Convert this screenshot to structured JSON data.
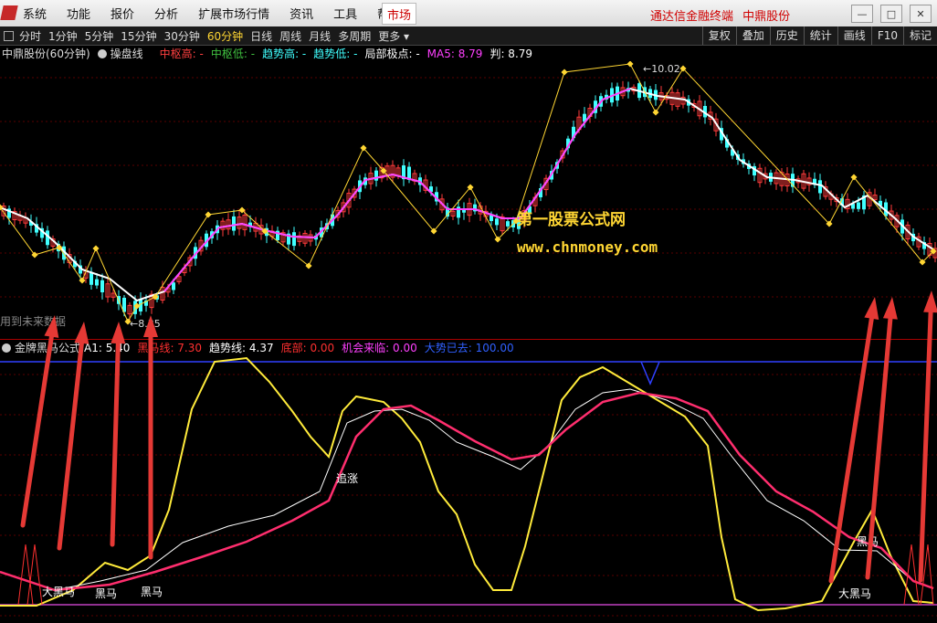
{
  "menu": {
    "items": [
      "系统",
      "功能",
      "报价",
      "分析",
      "扩展市场行情",
      "资讯",
      "工具",
      "帮助"
    ],
    "market_tab": "市场",
    "brand": "通达信金融终端",
    "stock": "中鼎股份"
  },
  "periods": {
    "items": [
      "分时",
      "1分钟",
      "5分钟",
      "15分钟",
      "30分钟",
      "60分钟",
      "日线",
      "周线",
      "月线",
      "多周期",
      "更多"
    ],
    "active": "60分钟",
    "right_items": [
      "复权",
      "叠加",
      "历史",
      "统计",
      "画线",
      "F10",
      "标记"
    ]
  },
  "main_info": {
    "stock_period": "中鼎股份(60分钟)",
    "indicator": "操盘线",
    "items": [
      {
        "label": "中枢高:",
        "value": "-",
        "color": "#ff4040"
      },
      {
        "label": "中枢低:",
        "value": "-",
        "color": "#40c040"
      },
      {
        "label": "趋势高:",
        "value": "-",
        "color": "#40ffff"
      },
      {
        "label": "趋势低:",
        "value": "-",
        "color": "#40ffff"
      },
      {
        "label": "局部极点:",
        "value": "-",
        "color": "#ffffff"
      },
      {
        "label": "MA5:",
        "value": "8.79",
        "color": "#ff40ff"
      },
      {
        "label": "判:",
        "value": "8.79",
        "color": "#ffffff"
      }
    ]
  },
  "price_labels": {
    "high": "10.02",
    "low": "8.35"
  },
  "watermark": {
    "line1": "第一股票公式网",
    "line2": "www.chnmoney.com"
  },
  "future_note": "用到未来数据",
  "sub_info": {
    "name": "金牌黑马公式",
    "items": [
      {
        "label": "A1:",
        "value": "5.40",
        "color": "#ffffff"
      },
      {
        "label": "黑马线:",
        "value": "7.30",
        "color": "#ff3030"
      },
      {
        "label": "趋势线:",
        "value": "4.37",
        "color": "#ffffff"
      },
      {
        "label": "底部:",
        "value": "0.00",
        "color": "#ff3030"
      },
      {
        "label": "机会来临:",
        "value": "0.00",
        "color": "#ff40ff"
      },
      {
        "label": "大势已去:",
        "value": "100.00",
        "color": "#3060ff"
      }
    ]
  },
  "annotations": [
    "大黑马",
    "黑马",
    "黑马",
    "追涨",
    "黑马",
    "大黑马"
  ],
  "colors": {
    "up": "#ff3b3b",
    "down": "#40ffff",
    "ma": "#ff40ff",
    "trend": "#ffffff",
    "zigzag": "#ffd633",
    "yellow": "#ffeb3b",
    "pink": "#ff2e6e",
    "blue": "#3040ff",
    "arrow": "#e53935"
  }
}
